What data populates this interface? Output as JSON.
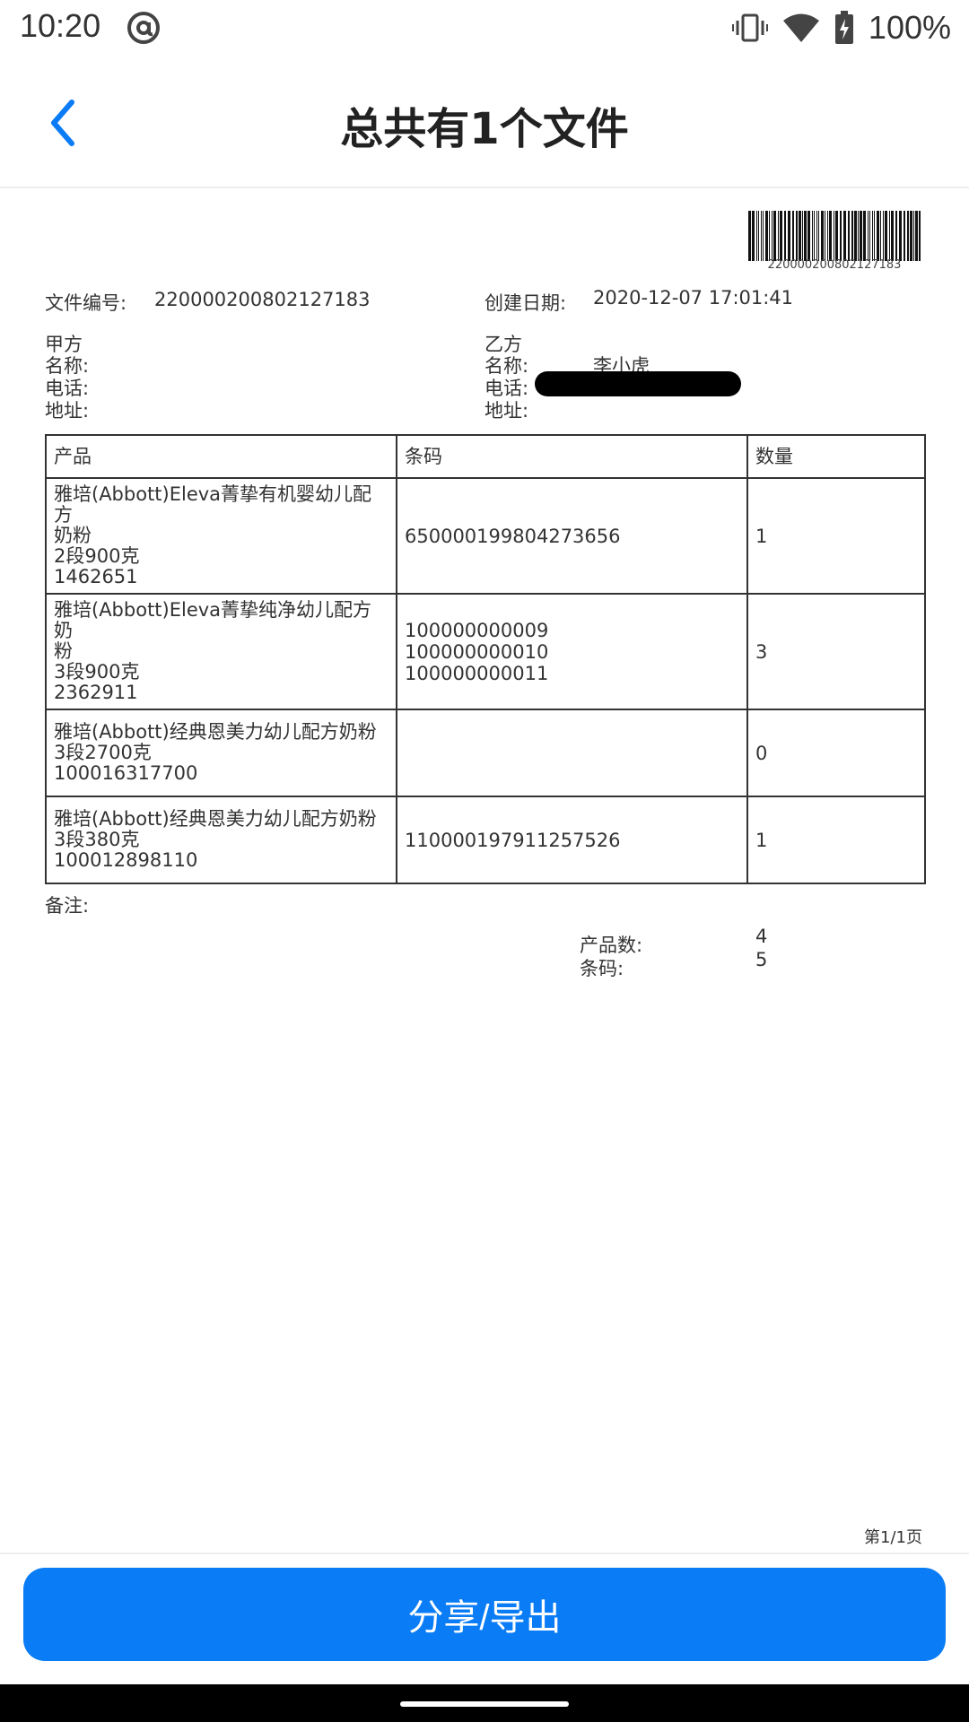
{
  "status": {
    "time": "10:20",
    "battery": "100%"
  },
  "header": {
    "title": "总共有1个文件"
  },
  "doc": {
    "barcode_number": "220000200802127183",
    "file_no_label": "文件编号:",
    "file_no": "220000200802127183",
    "created_label": "创建日期:",
    "created": "2020-12-07 17:01:41",
    "party_a": {
      "title": "甲方",
      "name_label": "名称:",
      "phone_label": "电话:",
      "address_label": "地址:"
    },
    "party_b": {
      "title": "乙方",
      "name_label": "名称:",
      "name": "李小虎",
      "phone_label": "电话:",
      "address_label": "地址:"
    },
    "table": {
      "headers": [
        "产品",
        "条码",
        "数量"
      ],
      "rows": [
        {
          "name_lines": [
            "雅培(Abbott)Eleva菁挚有机婴幼儿配方",
            "奶粉",
            "2段900克",
            "1462651"
          ],
          "barcodes": [
            "650000199804273656"
          ],
          "qty": "1"
        },
        {
          "name_lines": [
            "雅培(Abbott)Eleva菁挚纯净幼儿配方奶",
            "粉",
            "3段900克",
            "2362911"
          ],
          "barcodes": [
            "100000000009",
            "100000000010",
            "100000000011"
          ],
          "qty": "3"
        },
        {
          "name_lines": [
            "雅培(Abbott)经典恩美力幼儿配方奶粉",
            "3段2700克",
            "100016317700"
          ],
          "barcodes": [],
          "qty": "0"
        },
        {
          "name_lines": [
            "雅培(Abbott)经典恩美力幼儿配方奶粉",
            "3段380克",
            "100012898110"
          ],
          "barcodes": [
            "110000197911257526"
          ],
          "qty": "1"
        }
      ]
    },
    "remark_label": "备注:",
    "summary": {
      "products_label": "产品数:",
      "products": "4",
      "barcodes_label": "条码:",
      "barcodes": "5"
    },
    "page": "第1/1页"
  },
  "footer": {
    "share_label": "分享/导出"
  },
  "colors": {
    "accent": "#0a7cf6"
  }
}
